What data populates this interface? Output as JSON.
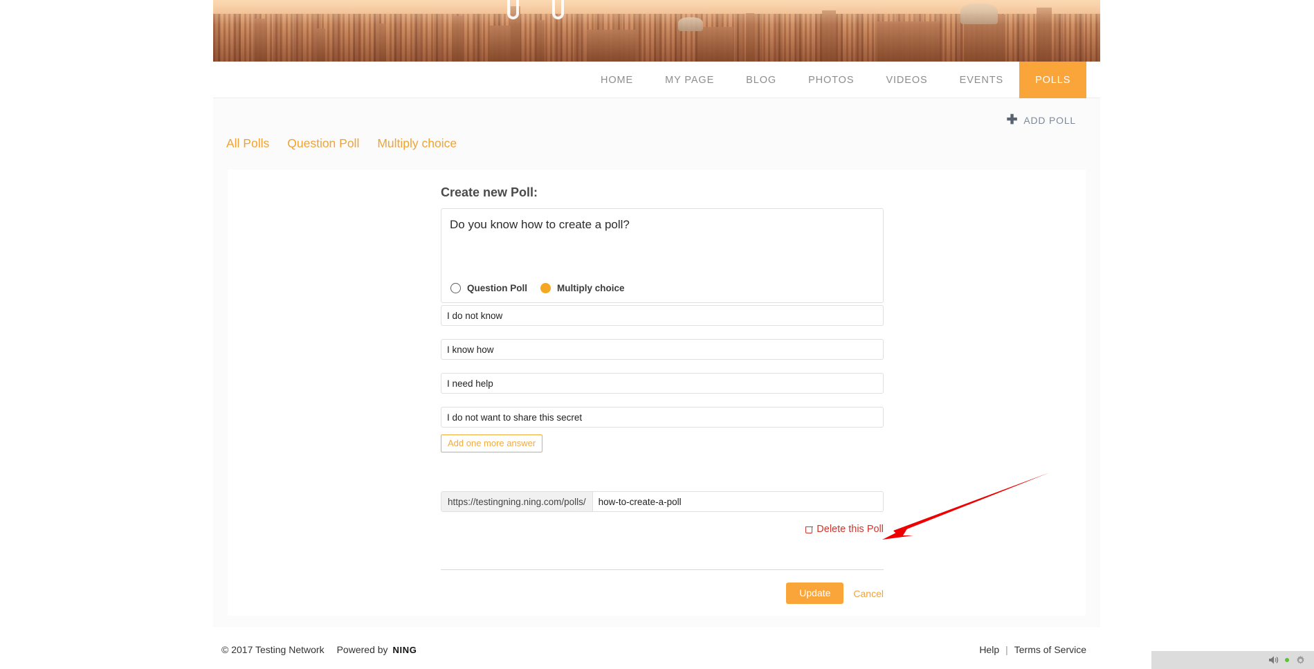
{
  "site": {
    "banner_alt": "Florence cityscape banner"
  },
  "nav": {
    "items": [
      {
        "label": "HOME",
        "active": false
      },
      {
        "label": "MY PAGE",
        "active": false
      },
      {
        "label": "BLOG",
        "active": false
      },
      {
        "label": "PHOTOS",
        "active": false
      },
      {
        "label": "VIDEOS",
        "active": false
      },
      {
        "label": "EVENTS",
        "active": false
      },
      {
        "label": "POLLS",
        "active": true
      }
    ]
  },
  "toolbar": {
    "add_poll_label": "ADD POLL",
    "add_poll_icon": "plus-icon"
  },
  "tabs": [
    {
      "label": "All Polls"
    },
    {
      "label": "Question Poll"
    },
    {
      "label": "Multiply choice"
    }
  ],
  "form": {
    "title": "Create new Poll:",
    "question": "Do you know how to create a poll?",
    "poll_types": [
      {
        "label": "Question Poll",
        "selected": false
      },
      {
        "label": "Multiply choice",
        "selected": true
      }
    ],
    "answers": [
      {
        "value": "I do not know"
      },
      {
        "value": "I know how"
      },
      {
        "value": "I need help"
      },
      {
        "value": "I do not want to share this secret"
      }
    ],
    "add_answer_label": "Add one more answer",
    "url": {
      "prefix": "https://testingning.ning.com/polls/",
      "slug": "how-to-create-a-poll"
    },
    "delete_label": "Delete this Poll",
    "delete_icon": "trash-icon",
    "update_label": "Update",
    "cancel_label": "Cancel"
  },
  "footer": {
    "copyright": "© 2017 Testing Network",
    "powered_by": "Powered by",
    "brand": "NING",
    "help_label": "Help",
    "separator": "|",
    "terms_label": "Terms of Service"
  },
  "taskbar": {
    "volume_icon": "speaker-icon",
    "status_icon": "green-dot-icon",
    "settings_icon": "gear-icon"
  },
  "annotation": {
    "arrow_color": "#ee0000",
    "points_to": "Delete this Poll"
  },
  "colors": {
    "accent": "#f9a53a",
    "tab_link": "#f0a334",
    "danger": "#d0342c",
    "page_bg": "#fbfbfb"
  }
}
